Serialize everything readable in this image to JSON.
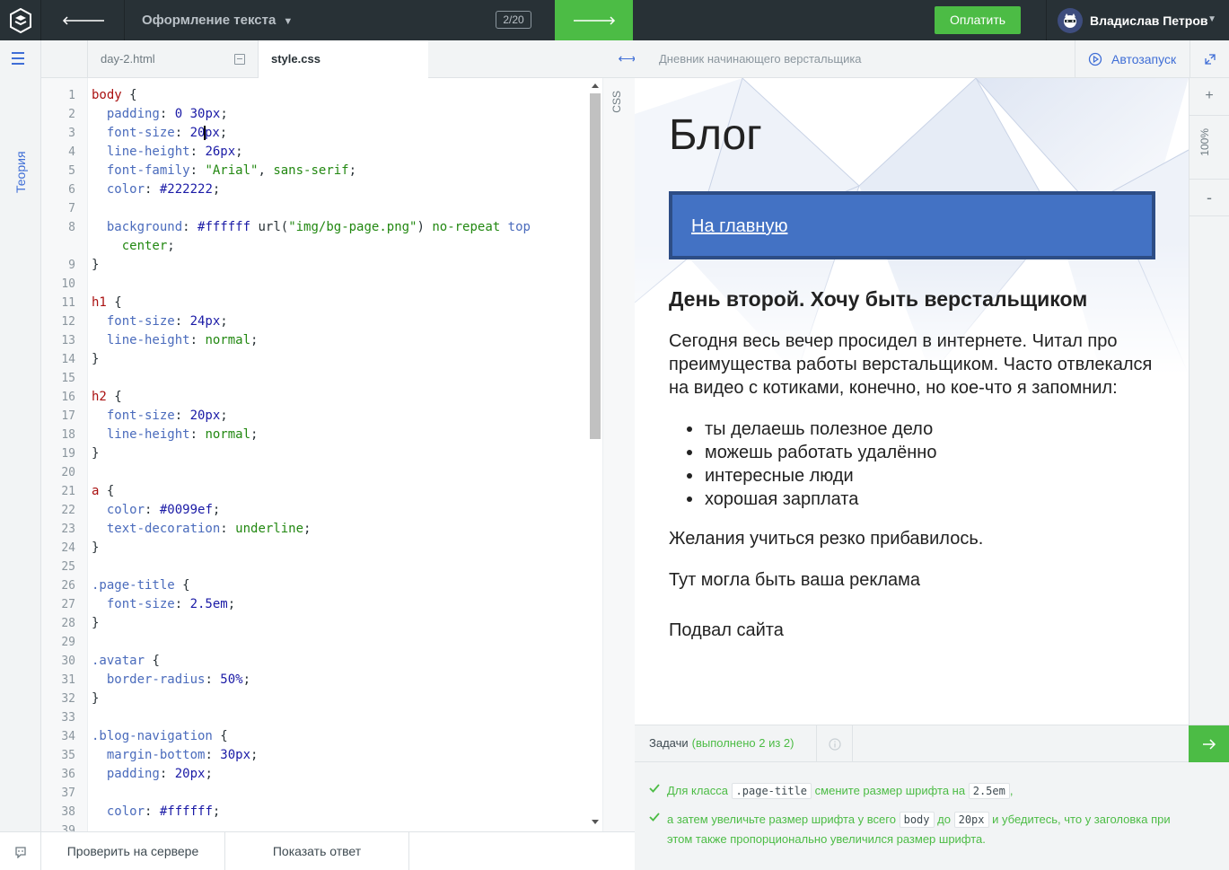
{
  "topbar": {
    "course_title": "Оформление текста",
    "step_counter": "2/20",
    "pay_label": "Оплатить",
    "user_name": "Владислав Петров"
  },
  "sidebar": {
    "theory_label": "Теория"
  },
  "editor": {
    "tabs": [
      {
        "label": "day-2.html",
        "active": false
      },
      {
        "label": "style.css",
        "active": true
      }
    ],
    "language_label": "CSS",
    "lines": [
      {
        "n": "1",
        "html": "<span class='sel'>body</span> <span class='pun'>{</span>"
      },
      {
        "n": "2",
        "html": "  <span class='prop'>padding</span>: <span class='val'>0 30px</span>;"
      },
      {
        "n": "3",
        "html": "  <span class='prop'>font-size</span>: <span class='val'>20<span class='cursor'></span>px</span>;"
      },
      {
        "n": "4",
        "html": "  <span class='prop'>line-height</span>: <span class='val'>26px</span>;"
      },
      {
        "n": "5",
        "html": "  <span class='prop'>font-family</span>: <span class='str'>\"Arial\"</span>, <span class='kw'>sans-serif</span>;"
      },
      {
        "n": "6",
        "html": "  <span class='prop'>color</span>: <span class='val'>#222222</span>;"
      },
      {
        "n": "7",
        "html": ""
      },
      {
        "n": "8",
        "html": "  <span class='prop'>background</span>: <span class='val'>#ffffff</span> url(<span class='str'>\"img/bg-page.png\"</span>) <span class='kw'>no-repeat</span> <span class='prop'>top</span>"
      },
      {
        "n": "",
        "html": "    <span class='kw'>center</span>;"
      },
      {
        "n": "9",
        "html": "<span class='pun'>}</span>"
      },
      {
        "n": "10",
        "html": ""
      },
      {
        "n": "11",
        "html": "<span class='sel'>h1</span> <span class='pun'>{</span>"
      },
      {
        "n": "12",
        "html": "  <span class='prop'>font-size</span>: <span class='val'>24px</span>;"
      },
      {
        "n": "13",
        "html": "  <span class='prop'>line-height</span>: <span class='kw'>normal</span>;"
      },
      {
        "n": "14",
        "html": "<span class='pun'>}</span>"
      },
      {
        "n": "15",
        "html": ""
      },
      {
        "n": "16",
        "html": "<span class='sel'>h2</span> <span class='pun'>{</span>"
      },
      {
        "n": "17",
        "html": "  <span class='prop'>font-size</span>: <span class='val'>20px</span>;"
      },
      {
        "n": "18",
        "html": "  <span class='prop'>line-height</span>: <span class='kw'>normal</span>;"
      },
      {
        "n": "19",
        "html": "<span class='pun'>}</span>"
      },
      {
        "n": "20",
        "html": ""
      },
      {
        "n": "21",
        "html": "<span class='sel'>a</span> <span class='pun'>{</span>"
      },
      {
        "n": "22",
        "html": "  <span class='prop'>color</span>: <span class='val'>#0099ef</span>;"
      },
      {
        "n": "23",
        "html": "  <span class='prop'>text-decoration</span>: <span class='kw'>underline</span>;"
      },
      {
        "n": "24",
        "html": "<span class='pun'>}</span>"
      },
      {
        "n": "25",
        "html": ""
      },
      {
        "n": "26",
        "html": "<span class='prop'>.page-title</span> <span class='pun'>{</span>"
      },
      {
        "n": "27",
        "html": "  <span class='prop'>font-size</span>: <span class='val'>2.5em</span>;"
      },
      {
        "n": "28",
        "html": "<span class='pun'>}</span>"
      },
      {
        "n": "29",
        "html": ""
      },
      {
        "n": "30",
        "html": "<span class='prop'>.avatar</span> <span class='pun'>{</span>"
      },
      {
        "n": "31",
        "html": "  <span class='prop'>border-radius</span>: <span class='val'>50%</span>;"
      },
      {
        "n": "32",
        "html": "<span class='pun'>}</span>"
      },
      {
        "n": "33",
        "html": ""
      },
      {
        "n": "34",
        "html": "<span class='prop'>.blog-navigation</span> <span class='pun'>{</span>"
      },
      {
        "n": "35",
        "html": "  <span class='prop'>margin-bottom</span>: <span class='val'>30px</span>;"
      },
      {
        "n": "36",
        "html": "  <span class='prop'>padding</span>: <span class='val'>20px</span>;"
      },
      {
        "n": "37",
        "html": ""
      },
      {
        "n": "38",
        "html": "  <span class='prop'>color</span>: <span class='val'>#ffffff</span>;"
      },
      {
        "n": "39",
        "html": ""
      }
    ]
  },
  "actions": {
    "check_label": "Проверить на сервере",
    "answer_label": "Показать ответ"
  },
  "preview": {
    "header_title": "Дневник начинающего верстальщика",
    "autorun_label": "Автозапуск",
    "zoom_level": "100%",
    "zoom_plus": "+",
    "zoom_minus": "-",
    "page": {
      "title": "Блог",
      "nav_link": "На главную",
      "heading": "День второй. Хочу быть верстальщиком",
      "paragraph": "Сегодня весь вечер просидел в интернете. Читал про преимущества работы верстальщиком. Часто отвлекался на видео с котиками, конечно, но кое-что я запомнил:",
      "list": [
        "ты делаешь полезное дело",
        "можешь работать удалённо",
        "интересные люди",
        "хорошая зарплата"
      ],
      "paragraph2": "Желания учиться резко прибавилось.",
      "ad": "Тут могла быть ваша реклама",
      "footer": "Подвал сайта"
    }
  },
  "tasks": {
    "label": "Задачи",
    "done_label": "(выполнено 2 из 2)",
    "items": [
      {
        "before": "Для класса",
        "chip1": ".page-title",
        "mid": "смените размер шрифта на",
        "chip2": "2.5em",
        "after": ","
      },
      {
        "before": "а затем увеличьте размер шрифта у всего",
        "chip1": "body",
        "mid": "до",
        "chip2": "20px",
        "after": "и убедитесь, что у заголовка при этом также пропорционально увеличился размер шрифта."
      }
    ]
  },
  "colors": {
    "topbar_bg": "#283136",
    "accent_green": "#4cbc45",
    "accent_blue": "#3f6ed6",
    "nav_blue": "#4372c4"
  }
}
